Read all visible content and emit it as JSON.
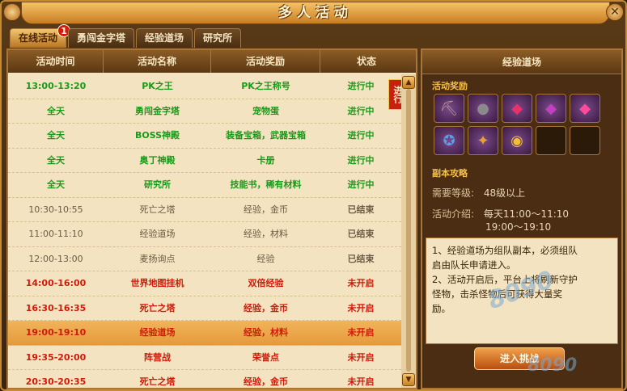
{
  "window": {
    "title": "多人活动",
    "close_glyph": "✕"
  },
  "tabs": [
    {
      "label": "在线活动",
      "badge": "1"
    },
    {
      "label": "勇闯金字塔"
    },
    {
      "label": "经验道场"
    },
    {
      "label": "研究所"
    }
  ],
  "table": {
    "headers": [
      "活动时间",
      "活动名称",
      "活动奖励",
      "状态"
    ],
    "flag_label": "进行",
    "rows": [
      {
        "time": "13:00-13:20",
        "name": "PK之王",
        "reward": "PK之王称号",
        "status": "进行中",
        "state": "active"
      },
      {
        "time": "全天",
        "name": "勇闯金字塔",
        "reward": "宠物蛋",
        "status": "进行中",
        "state": "active"
      },
      {
        "time": "全天",
        "name": "BOSS神殿",
        "reward": "装备宝箱，武器宝箱",
        "status": "进行中",
        "state": "active"
      },
      {
        "time": "全天",
        "name": "奥丁神殿",
        "reward": "卡册",
        "status": "进行中",
        "state": "active"
      },
      {
        "time": "全天",
        "name": "研究所",
        "reward": "技能书，稀有材料",
        "status": "进行中",
        "state": "active"
      },
      {
        "time": "10:30-10:55",
        "name": "死亡之塔",
        "reward": "经验，金币",
        "status": "已结束",
        "state": "ended"
      },
      {
        "time": "11:00-11:10",
        "name": "经验道场",
        "reward": "经验，材料",
        "status": "已结束",
        "state": "ended"
      },
      {
        "time": "12:00-13:00",
        "name": "麦扬询点",
        "reward": "经验",
        "status": "已结束",
        "state": "ended"
      },
      {
        "time": "14:00-16:00",
        "name": "世界地图挂机",
        "reward": "双倍经验",
        "status": "未开启",
        "state": "pending"
      },
      {
        "time": "16:30-16:35",
        "name": "死亡之塔",
        "reward": "经验，金币",
        "status": "未开启",
        "state": "pending"
      },
      {
        "time": "19:00-19:10",
        "name": "经验道场",
        "reward": "经验，材料",
        "status": "未开启",
        "state": "pending",
        "selected": true
      },
      {
        "time": "19:35-20:00",
        "name": "阵营战",
        "reward": "荣誉点",
        "status": "未开启",
        "state": "pending"
      },
      {
        "time": "20:30-20:35",
        "name": "死亡之塔",
        "reward": "经验，金币",
        "status": "未开启",
        "state": "pending"
      }
    ]
  },
  "detail": {
    "title": "经验道场",
    "rewards_label": "活动奖励",
    "reward_icons": [
      "ore-icon",
      "stone-icon",
      "red-gem-icon",
      "purple-gem-icon",
      "pink-gem-icon",
      "exp-icon",
      "job-icon",
      "gold-coin-icon",
      "empty-slot",
      "empty-slot"
    ],
    "strategy_label": "副本攻略",
    "level_label": "需要等级:",
    "level_value": "48级以上",
    "intro_label": "活动介绍:",
    "intro_line1": "每天11:00～11:10",
    "intro_line2": "19:00～19:10",
    "desc_line1": "1、经验道场为组队副本，必须组队",
    "desc_line2": "启由队长申请进入。",
    "desc_line3": "2、活动开启后，平台上将刷新守护",
    "desc_line4": "怪物，击杀怪物后可获得大量奖",
    "desc_line5": "励。",
    "enter_label": "进入挑战"
  },
  "colors": {
    "active": "#1a9a1a",
    "ended": "#6b5a44",
    "pending": "#d21a0a",
    "selected_bg": "#e49a3c"
  }
}
